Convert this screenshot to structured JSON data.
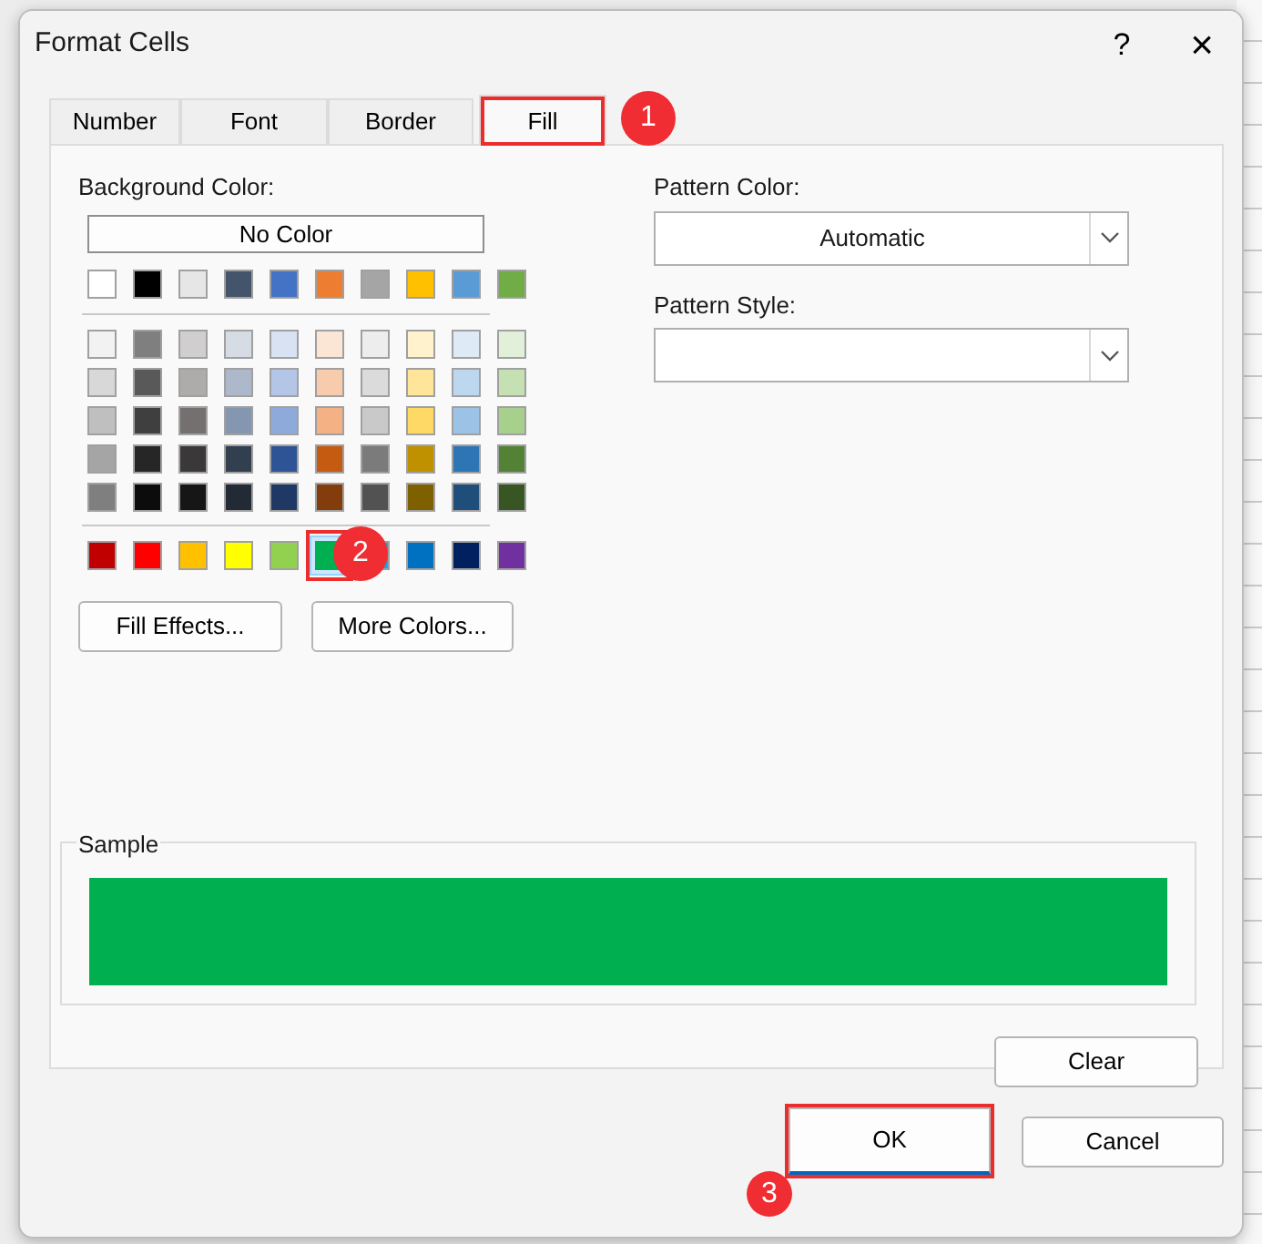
{
  "window": {
    "title": "Format Cells",
    "help": "?",
    "close": "×"
  },
  "tabs": [
    {
      "label": "Number",
      "selected": false,
      "highlighted": false
    },
    {
      "label": "Font",
      "selected": false,
      "highlighted": false
    },
    {
      "label": "Border",
      "selected": false,
      "highlighted": false
    },
    {
      "label": "Fill",
      "selected": true,
      "highlighted": true
    }
  ],
  "background_color": {
    "label": "Background Color:",
    "no_color": "No Color",
    "theme_colors": [
      {
        "color": "#ffffff",
        "selected": false
      },
      {
        "color": "#000000",
        "selected": false
      },
      {
        "color": "#e7e6e6",
        "selected": false
      },
      {
        "color": "#44546a",
        "selected": false
      },
      {
        "color": "#4472c4",
        "selected": false
      },
      {
        "color": "#ed7d31",
        "selected": false
      },
      {
        "color": "#a5a5a5",
        "selected": false
      },
      {
        "color": "#ffc000",
        "selected": false
      },
      {
        "color": "#5b9bd5",
        "selected": false
      },
      {
        "color": "#70ad47",
        "selected": false
      }
    ],
    "shade_rows": [
      [
        {
          "color": "#f2f2f2",
          "selected": false
        },
        {
          "color": "#7f7f7f",
          "selected": false
        },
        {
          "color": "#d0cece",
          "selected": false
        },
        {
          "color": "#d6dce4",
          "selected": false
        },
        {
          "color": "#d9e2f3",
          "selected": false
        },
        {
          "color": "#fbe5d5",
          "selected": false
        },
        {
          "color": "#ededed",
          "selected": false
        },
        {
          "color": "#fff2cc",
          "selected": false
        },
        {
          "color": "#deebf6",
          "selected": false
        },
        {
          "color": "#e2efd9",
          "selected": false
        }
      ],
      [
        {
          "color": "#d8d8d8",
          "selected": false
        },
        {
          "color": "#595959",
          "selected": false
        },
        {
          "color": "#aeabab",
          "selected": false
        },
        {
          "color": "#adb9ca",
          "selected": false
        },
        {
          "color": "#b4c6e7",
          "selected": false
        },
        {
          "color": "#f7cbac",
          "selected": false
        },
        {
          "color": "#dbdbdb",
          "selected": false
        },
        {
          "color": "#fee599",
          "selected": false
        },
        {
          "color": "#bdd7ee",
          "selected": false
        },
        {
          "color": "#c5e0b3",
          "selected": false
        }
      ],
      [
        {
          "color": "#bfbfbf",
          "selected": false
        },
        {
          "color": "#3f3f3f",
          "selected": false
        },
        {
          "color": "#757070",
          "selected": false
        },
        {
          "color": "#8496b0",
          "selected": false
        },
        {
          "color": "#8eaadb",
          "selected": false
        },
        {
          "color": "#f4b183",
          "selected": false
        },
        {
          "color": "#c9c9c9",
          "selected": false
        },
        {
          "color": "#ffd965",
          "selected": false
        },
        {
          "color": "#9cc3e5",
          "selected": false
        },
        {
          "color": "#a8d08d",
          "selected": false
        }
      ],
      [
        {
          "color": "#a5a5a5",
          "selected": false
        },
        {
          "color": "#262626",
          "selected": false
        },
        {
          "color": "#3a3838",
          "selected": false
        },
        {
          "color": "#323f4f",
          "selected": false
        },
        {
          "color": "#2f5496",
          "selected": false
        },
        {
          "color": "#c55a11",
          "selected": false
        },
        {
          "color": "#7b7b7b",
          "selected": false
        },
        {
          "color": "#bf9000",
          "selected": false
        },
        {
          "color": "#2e75b5",
          "selected": false
        },
        {
          "color": "#538135",
          "selected": false
        }
      ],
      [
        {
          "color": "#7f7f7f",
          "selected": false
        },
        {
          "color": "#0c0c0c",
          "selected": false
        },
        {
          "color": "#171616",
          "selected": false
        },
        {
          "color": "#222a35",
          "selected": false
        },
        {
          "color": "#1f3864",
          "selected": false
        },
        {
          "color": "#833c0b",
          "selected": false
        },
        {
          "color": "#525252",
          "selected": false
        },
        {
          "color": "#7f6000",
          "selected": false
        },
        {
          "color": "#1e4e79",
          "selected": false
        },
        {
          "color": "#375623",
          "selected": false
        }
      ]
    ],
    "standard_colors": [
      {
        "color": "#c00000",
        "selected": false,
        "highlighted": false
      },
      {
        "color": "#ff0000",
        "selected": false,
        "highlighted": false
      },
      {
        "color": "#ffc000",
        "selected": false,
        "highlighted": false
      },
      {
        "color": "#ffff00",
        "selected": false,
        "highlighted": false
      },
      {
        "color": "#92d050",
        "selected": false,
        "highlighted": false
      },
      {
        "color": "#00b050",
        "selected": true,
        "highlighted": true
      },
      {
        "color": "#00b0f0",
        "selected": false,
        "highlighted": false
      },
      {
        "color": "#0070c0",
        "selected": false,
        "highlighted": false
      },
      {
        "color": "#002060",
        "selected": false,
        "highlighted": false
      },
      {
        "color": "#7030a0",
        "selected": false,
        "highlighted": false
      }
    ],
    "buttons": [
      "Fill Effects...",
      "More Colors..."
    ]
  },
  "pattern_color": {
    "label": "Pattern Color:",
    "value": "Automatic"
  },
  "pattern_style": {
    "label": "Pattern Style:"
  },
  "sample": {
    "label": "Sample",
    "color": "#00b050"
  },
  "clear_button": "Clear",
  "footer_buttons": [
    {
      "label": "OK",
      "highlighted": true
    },
    {
      "label": "Cancel",
      "highlighted": false
    }
  ],
  "callouts": [
    {
      "label": "1"
    },
    {
      "label": "2"
    },
    {
      "label": "3"
    }
  ]
}
